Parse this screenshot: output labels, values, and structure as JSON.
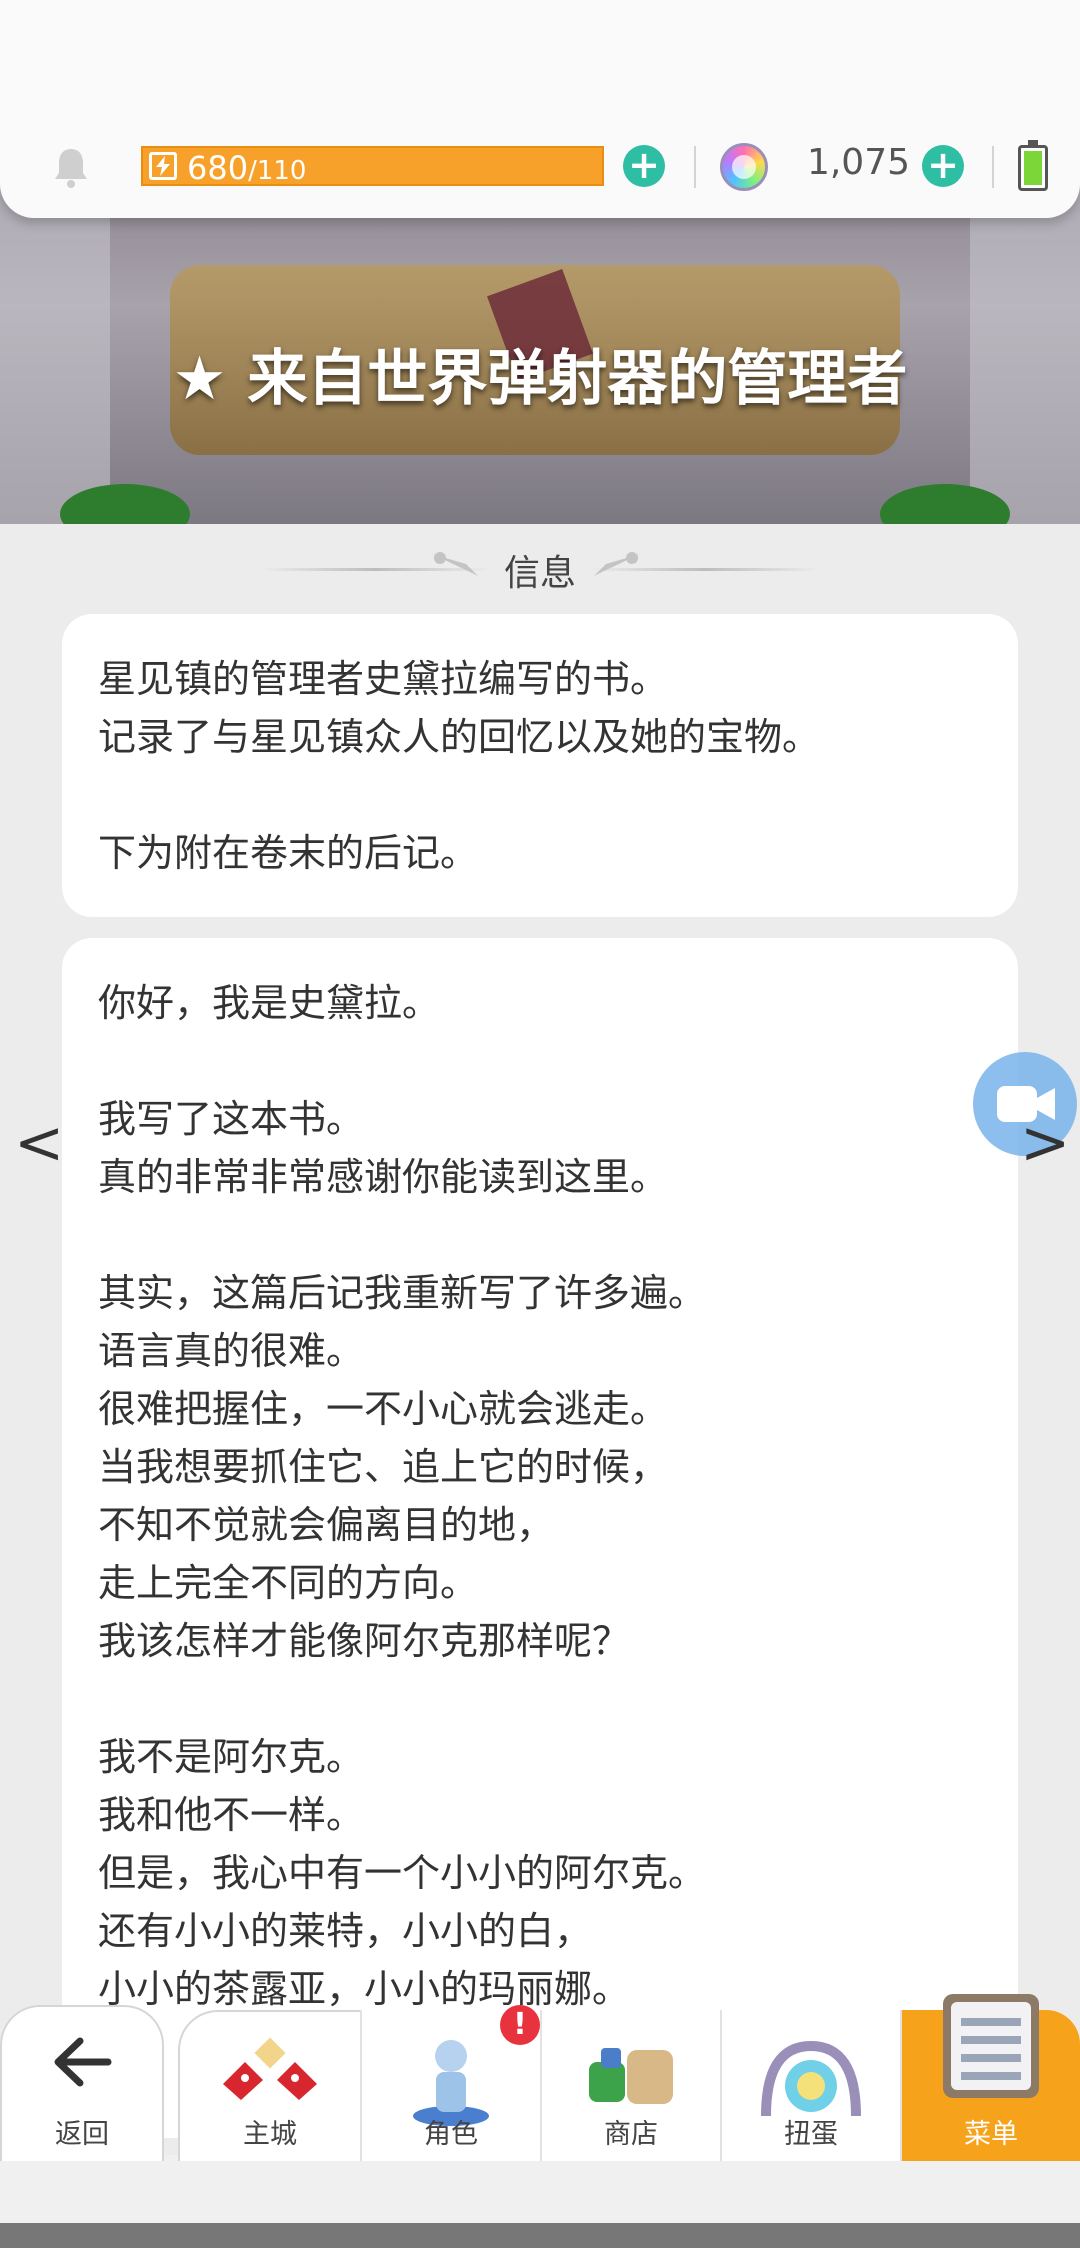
{
  "status_bar": {
    "energy_current": "680",
    "energy_max": "/110",
    "gem_count": "1,075",
    "plus_symbol": "+"
  },
  "banner": {
    "title": "★ 来自世界弹射器的管理者"
  },
  "section": {
    "title": "信息"
  },
  "info_card": {
    "lines": [
      "星见镇的管理者史黛拉编写的书。",
      "记录了与星见镇众人的回忆以及她的宝物。",
      "",
      "下为附在卷末的后记。"
    ]
  },
  "body_card": {
    "lines": [
      "你好，我是史黛拉。",
      "",
      "我写了这本书。",
      "真的非常非常感谢你能读到这里。",
      "",
      "其实，这篇后记我重新写了许多遍。",
      "语言真的很难。",
      "很难把握住，一不小心就会逃走。",
      "当我想要抓住它、追上它的时候，",
      "不知不觉就会偏离目的地，",
      "走上完全不同的方向。",
      "我该怎样才能像阿尔克那样呢？",
      "",
      "我不是阿尔克。",
      "我和他不一样。",
      "但是，我心中有一个小小的阿尔克。",
      "还有小小的莱特，小小的白，",
      "小小的茶露亚，小小的玛丽娜。"
    ]
  },
  "navigation": {
    "prev_arrow": "<",
    "next_arrow": ">",
    "badge_text": "!",
    "items": [
      {
        "label": "返回"
      },
      {
        "label": "主城"
      },
      {
        "label": "角色"
      },
      {
        "label": "商店"
      },
      {
        "label": "扭蛋"
      },
      {
        "label": "菜单"
      }
    ]
  },
  "colors": {
    "energy_bar": "#f7a12a",
    "plus_button": "#2dbea4",
    "active_tab": "#f6a21b",
    "badge": "#e8333f",
    "video_button": "#78b4eb"
  }
}
